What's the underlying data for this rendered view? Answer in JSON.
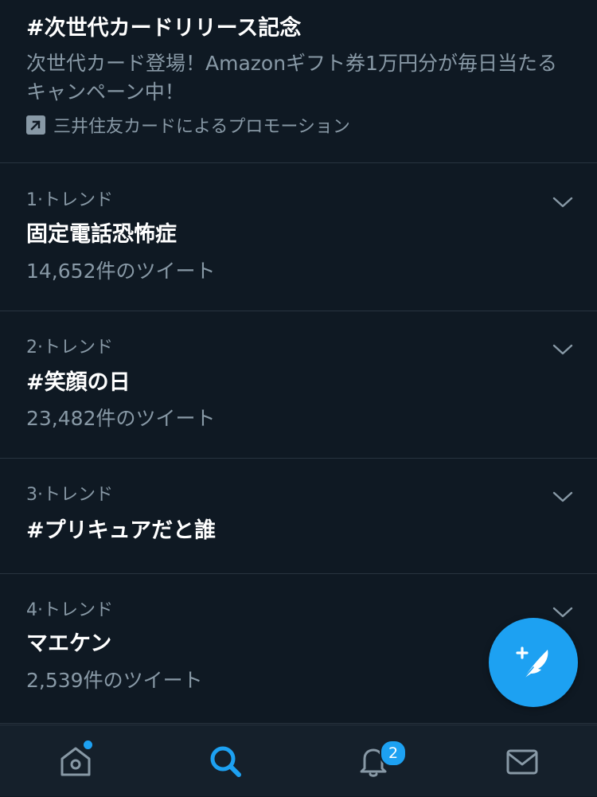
{
  "promoted": {
    "title": "#次世代カードリリース記念",
    "description": "次世代カード登場！Amazonギフト券1万円分が毎日当たるキャンペーン中！",
    "promoted_by": "三井住友カードによるプロモーション"
  },
  "trends": [
    {
      "meta": "1·トレンド",
      "name": "固定電話恐怖症",
      "count": "14,652件のツイート"
    },
    {
      "meta": "2·トレンド",
      "name": "#笑顔の日",
      "count": "23,482件のツイート"
    },
    {
      "meta": "3·トレンド",
      "name": "#プリキュアだと誰",
      "count": ""
    },
    {
      "meta": "4·トレンド",
      "name": "マエケン",
      "count": "2,539件のツイート"
    }
  ],
  "tabbar": {
    "notifications_badge": "2",
    "icons": [
      "home-icon",
      "search-icon",
      "bell-icon",
      "mail-icon"
    ]
  },
  "colors": {
    "background": "#0f1923",
    "accent": "#1da1f2",
    "muted_text": "#8899a6",
    "divider": "#28343f"
  }
}
